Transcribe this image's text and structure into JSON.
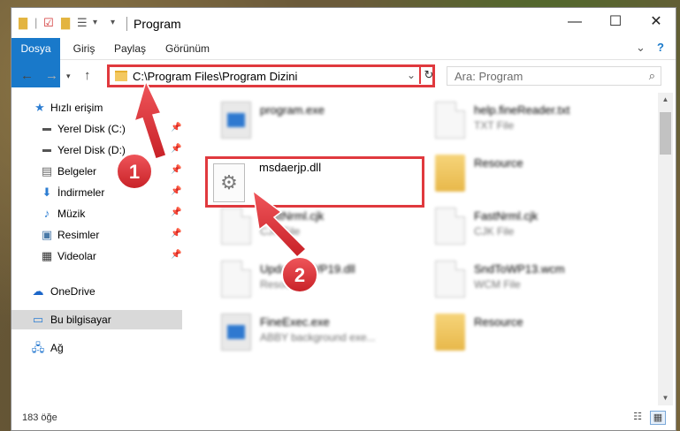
{
  "window": {
    "title": "Program",
    "controls": {
      "minimize": "—",
      "maximize": "☐",
      "close": "✕"
    }
  },
  "ribbon": {
    "tabs": [
      {
        "label": "Dosya"
      },
      {
        "label": "Giriş"
      },
      {
        "label": "Paylaş"
      },
      {
        "label": "Görünüm"
      }
    ],
    "expand_icon": "chevron-down-icon",
    "help_icon": "help-icon"
  },
  "address": {
    "path": "C:\\Program Files\\Program Dizini",
    "search_placeholder": "Ara: Program"
  },
  "navpane": {
    "items": [
      {
        "label": "Hızlı erişim",
        "icon": "star-icon"
      },
      {
        "label": "Yerel Disk (C:)",
        "icon": "drive-icon",
        "pinned": true
      },
      {
        "label": "Yerel Disk (D:)",
        "icon": "drive-icon",
        "pinned": true
      },
      {
        "label": "Belgeler",
        "icon": "documents-icon",
        "pinned": true
      },
      {
        "label": "İndirmeler",
        "icon": "download-icon",
        "pinned": true
      },
      {
        "label": "Müzik",
        "icon": "music-icon",
        "pinned": true
      },
      {
        "label": "Resimler",
        "icon": "pictures-icon",
        "pinned": true
      },
      {
        "label": "Videolar",
        "icon": "videos-icon",
        "pinned": true
      },
      {
        "label": "OneDrive",
        "icon": "cloud-icon"
      },
      {
        "label": "Bu bilgisayar",
        "icon": "computer-icon",
        "selected": true
      },
      {
        "label": "Ağ",
        "icon": "network-icon"
      }
    ]
  },
  "files": {
    "left": [
      {
        "name": "program.exe",
        "type": ""
      },
      {
        "name": "msdaerjp.dll",
        "type": ""
      },
      {
        "name": "FastNrml.cjk",
        "type": "CJK File"
      },
      {
        "name": "UpdateToWP19.dll",
        "type": "Resource"
      },
      {
        "name": "FineExec.exe",
        "type": "ABBY background exe..."
      }
    ],
    "right": [
      {
        "name": "help.fineReader.txt",
        "type": "TXT File"
      },
      {
        "name": "Resource",
        "type": ""
      },
      {
        "name": "FastNrml.cjk",
        "type": "CJK File"
      },
      {
        "name": "SndToWP13.wcm",
        "type": "WCM File"
      },
      {
        "name": "Resource",
        "type": ""
      }
    ]
  },
  "status": {
    "count": "183 öğe"
  },
  "callouts": [
    {
      "number": "1"
    },
    {
      "number": "2"
    }
  ],
  "colors": {
    "accent": "#1979ca",
    "highlight": "#e0393e"
  }
}
